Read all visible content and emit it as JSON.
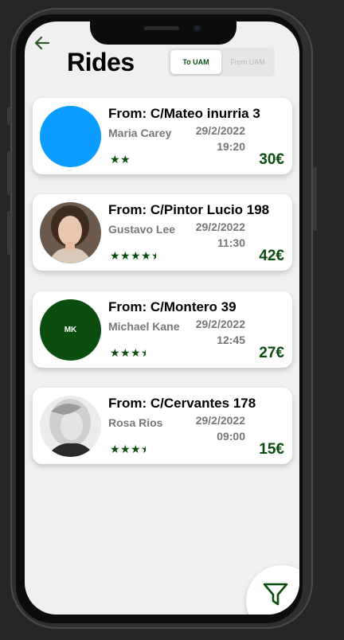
{
  "header": {
    "title": "Rides",
    "toggle": {
      "active_label": "To UAM",
      "inactive_label": "From UAM"
    }
  },
  "rides": [
    {
      "from": "From: C/Mateo inurria 3",
      "name": "Maria Carey",
      "date": "29/2/2022",
      "time": "19:20",
      "price": "30€",
      "rating": 2,
      "avatar_color": "#0a9cff"
    },
    {
      "from": "From: C/Pintor Lucio 198",
      "name": "Gustavo Lee",
      "date": "29/2/2022",
      "time": "11:30",
      "price": "42€",
      "rating": 4.5
    },
    {
      "from": "From: C/Montero 39",
      "name": "Michael Kane",
      "date": "29/2/2022",
      "time": "12:45",
      "price": "27€",
      "rating": 3.5,
      "avatar_initials": "MK",
      "avatar_color": "#0b4d0f"
    },
    {
      "from": "From: C/Cervantes 178",
      "name": "Rosa Rios",
      "date": "29/2/2022",
      "time": "09:00",
      "price": "15€",
      "rating": 3.5
    }
  ],
  "colors": {
    "accent": "#0b4d0f",
    "background": "#f0f0f0",
    "card": "#ffffff"
  },
  "icons": {
    "back": "arrow-left-icon",
    "filter": "funnel-icon",
    "star": "star-icon"
  }
}
